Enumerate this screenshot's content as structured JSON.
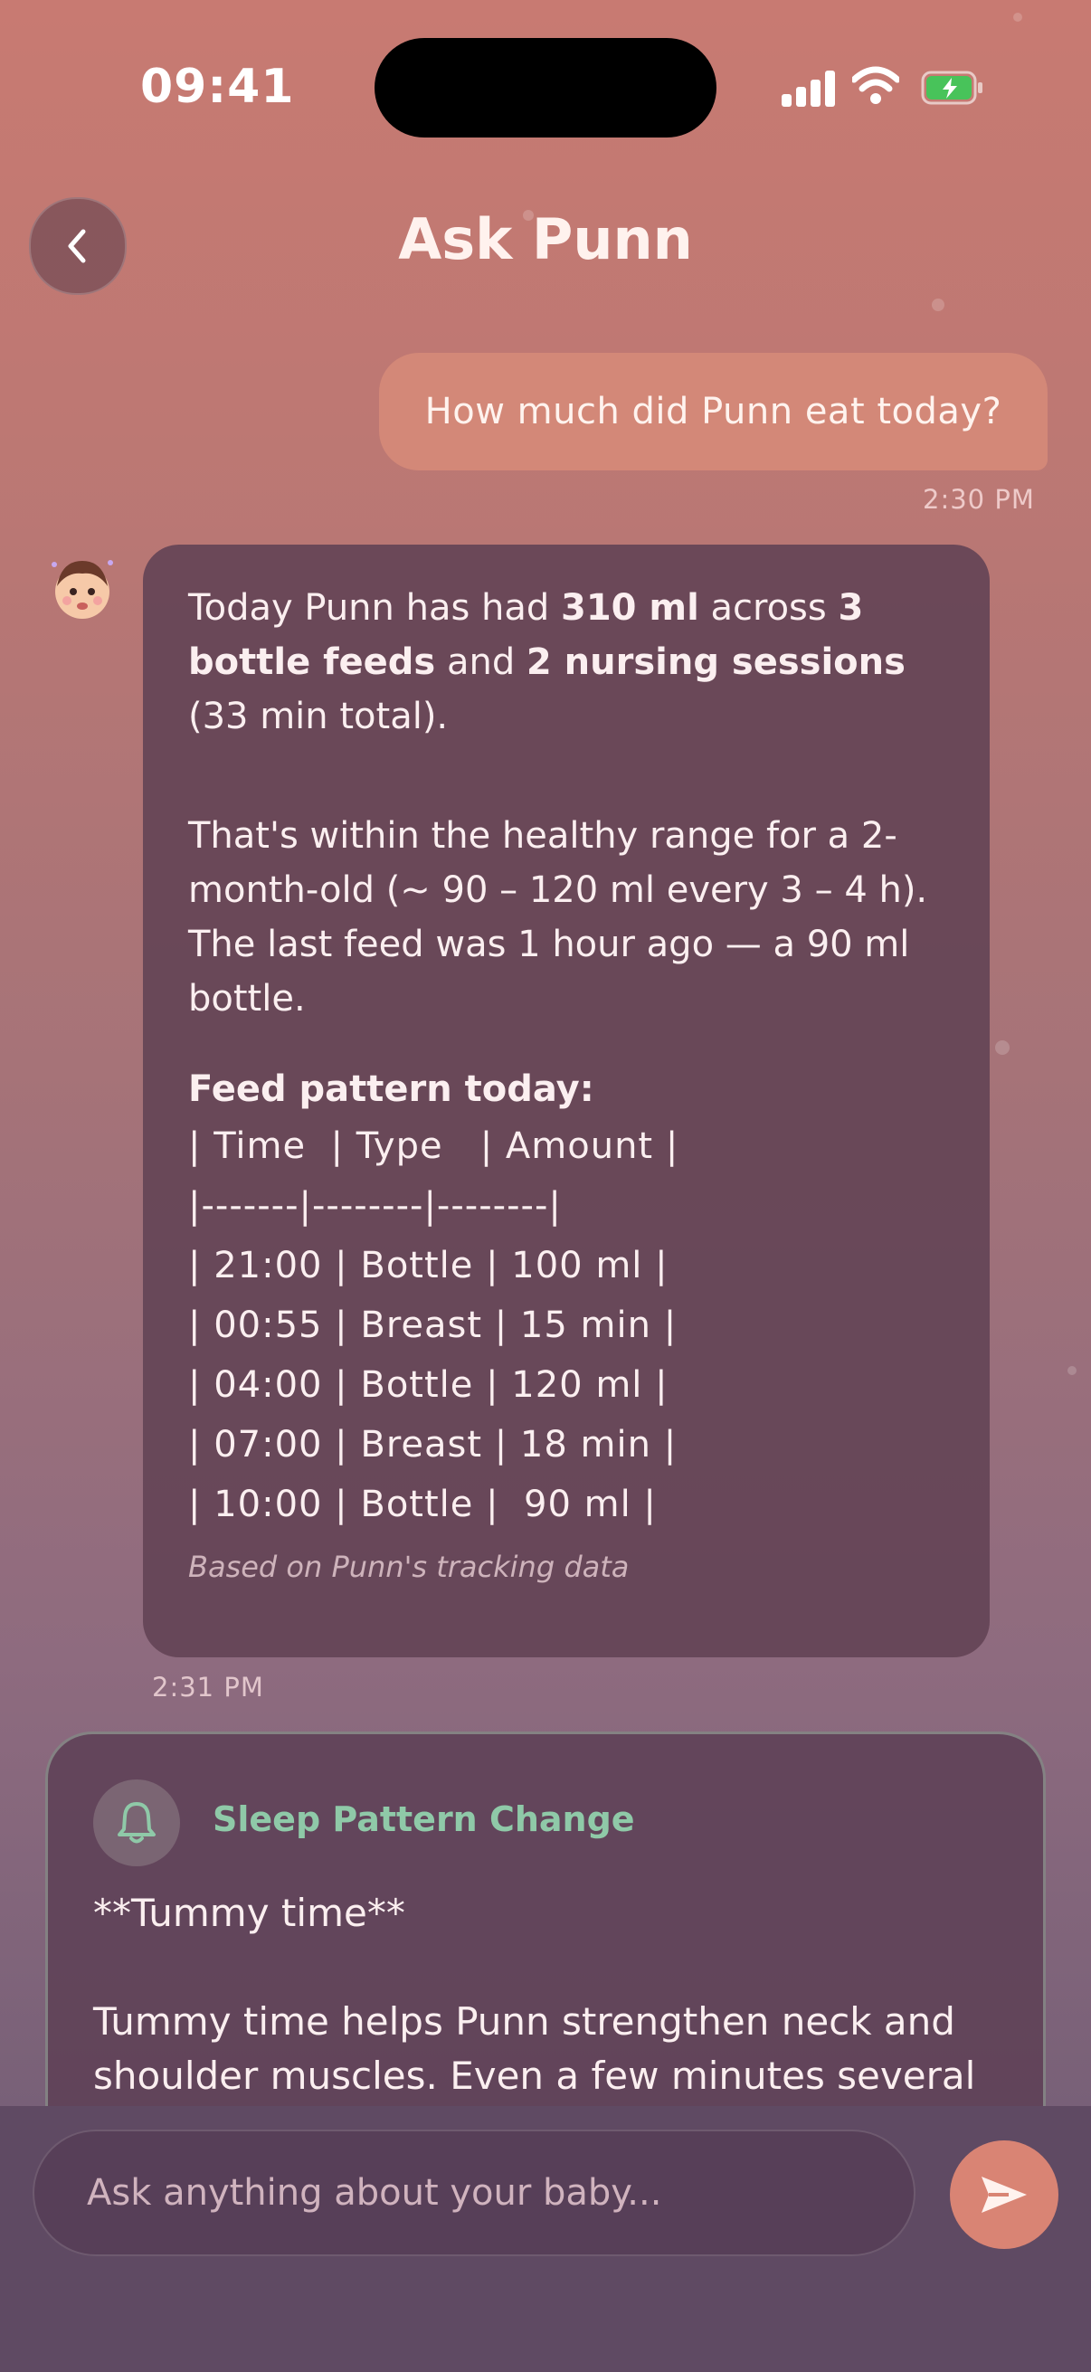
{
  "status_bar": {
    "time": "09:41"
  },
  "header": {
    "title": "Ask Punn",
    "back_icon": "chevron-left-icon"
  },
  "conversation": {
    "user_message": {
      "text": "How much did Punn eat today?",
      "timestamp": "2:30 PM"
    },
    "assistant_message": {
      "avatar_icon": "baby-face-icon",
      "p1_a": "Today Punn has had ",
      "p1_b": "310 ml",
      "p1_c": " across ",
      "p1_d": "3 bottle feeds",
      "p1_e": " and ",
      "p1_f": "2 nursing sessions",
      "p1_g": " (33 min total).",
      "p2": "That's within the healthy range for a 2-month-old (~ 90 – 120 ml every 3 – 4 h). The last feed was 1 hour ago — a 90 ml bottle.",
      "pattern_title": "Feed pattern today:",
      "table_lines": [
        "| Time  | Type   | Amount |",
        "|-------|--------|--------|",
        "| 21:00 | Bottle | 100 ml |",
        "| 00:55 | Breast | 15 min |",
        "| 04:00 | Bottle | 120 ml |",
        "| 07:00 | Breast | 18 min |",
        "| 10:00 | Bottle |  90 ml |"
      ],
      "source_note": "Based on Punn's tracking data",
      "timestamp": "2:31 PM"
    },
    "alert_card": {
      "icon": "bell-icon",
      "title": "Sleep Pattern Change",
      "heading": "**Tummy time**",
      "body": "Tummy time helps Punn strengthen neck and shoulder muscles. Even a few minutes several"
    }
  },
  "composer": {
    "placeholder": "Ask anything about your baby...",
    "send_icon": "send-icon"
  },
  "colors": {
    "user_bubble": "#d38878",
    "assistant_bubble": "#644456",
    "alert_title": "#8fc9a8",
    "send_button": "#d98474"
  }
}
